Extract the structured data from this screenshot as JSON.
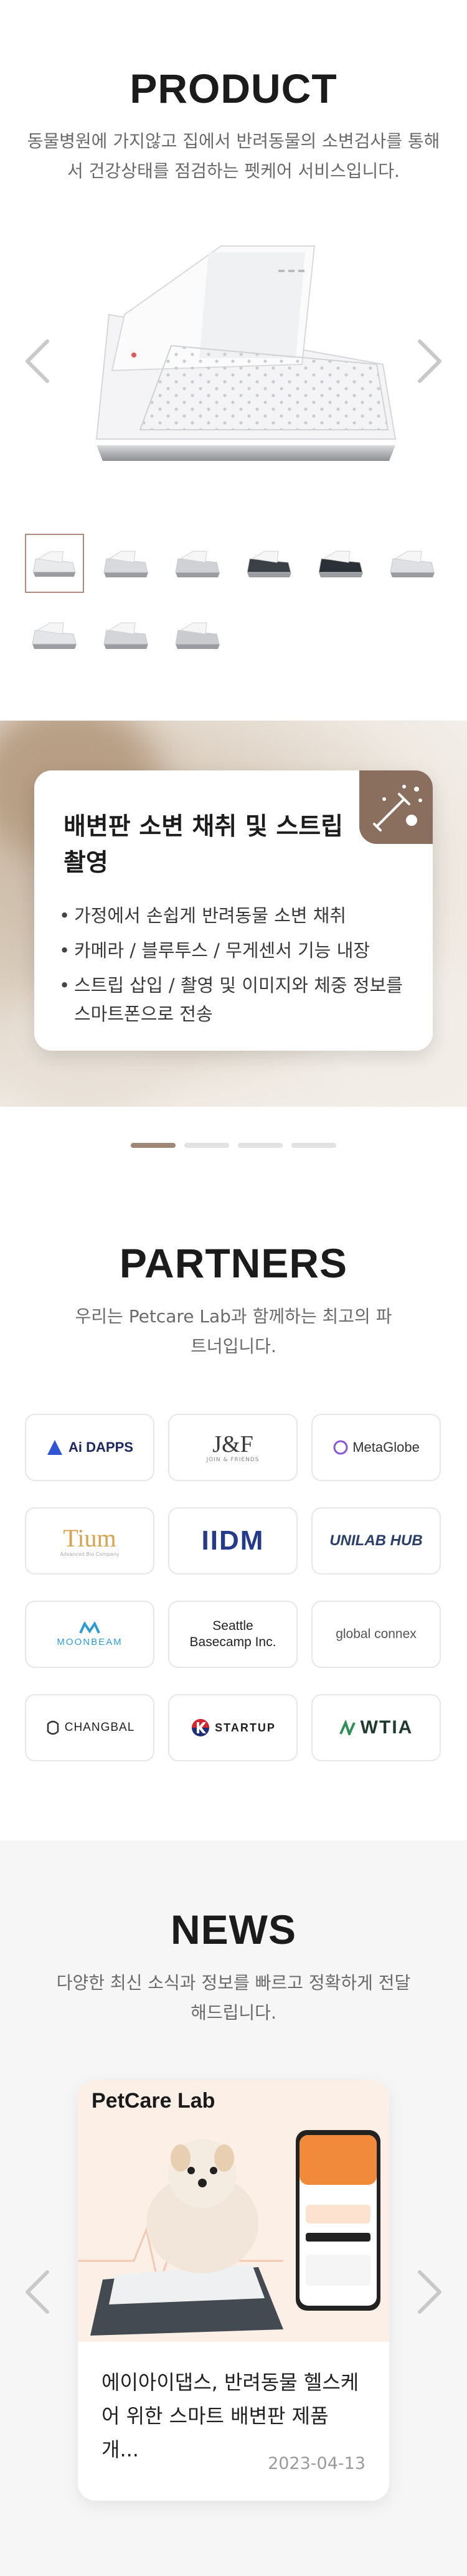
{
  "product": {
    "title": "PRODUCT",
    "description": "동물병원에 가지않고 집에서 반려동물의 소변검사를 통해서 건강상태를 점검하는 펫케어 서비스입니다.",
    "thumbnail_count": 9,
    "active_thumbnail": 1
  },
  "feature": {
    "title": "배변판 소변 채취 및 스트립 촬영",
    "items": [
      "가정에서 손쉽게 반려동물 소변 채취",
      "카메라 / 블루투스 / 무게센서 기능 내장",
      "스트립 삽입 / 촬영 및 이미지와 체중 정보를 스마트폰으로 전송"
    ],
    "icon": "test-tube-icon",
    "slide_count": 4,
    "active_slide": 1
  },
  "partners": {
    "title": "PARTNERS",
    "description": "우리는 Petcare Lab과 함께하는 최고의 파트너입니다.",
    "logos": [
      {
        "name": "Ai DAPPS"
      },
      {
        "name": "J&F",
        "sub": "JOIN & FRIENDS"
      },
      {
        "name": "MetaGlobe"
      },
      {
        "name": "Tium",
        "sub": "Advanced Bio Company"
      },
      {
        "name": "IIDM"
      },
      {
        "name": "UNILAB HUB"
      },
      {
        "name": "MOONBEAM"
      },
      {
        "name": "Seattle Basecamp Inc."
      },
      {
        "name": "global connex"
      },
      {
        "name": "CHANGBAL"
      },
      {
        "name": "STARTUP"
      },
      {
        "name": "WTIA"
      }
    ]
  },
  "news": {
    "title": "NEWS",
    "description": "다양한 최신 소식과 정보를 빠르고 정확하게 전달해드립니다.",
    "items": [
      {
        "brand": "PetCare Lab",
        "title": "에이아이댑스, 반려동물 헬스케어 위한 스마트 배변판 제품 개...",
        "date": "2023-04-13"
      }
    ]
  },
  "colors": {
    "accent": "#a08675",
    "card_icon_bg": "#8a6f5e",
    "text_dark": "#1b1b1b",
    "text_muted": "#6a6a6a"
  }
}
